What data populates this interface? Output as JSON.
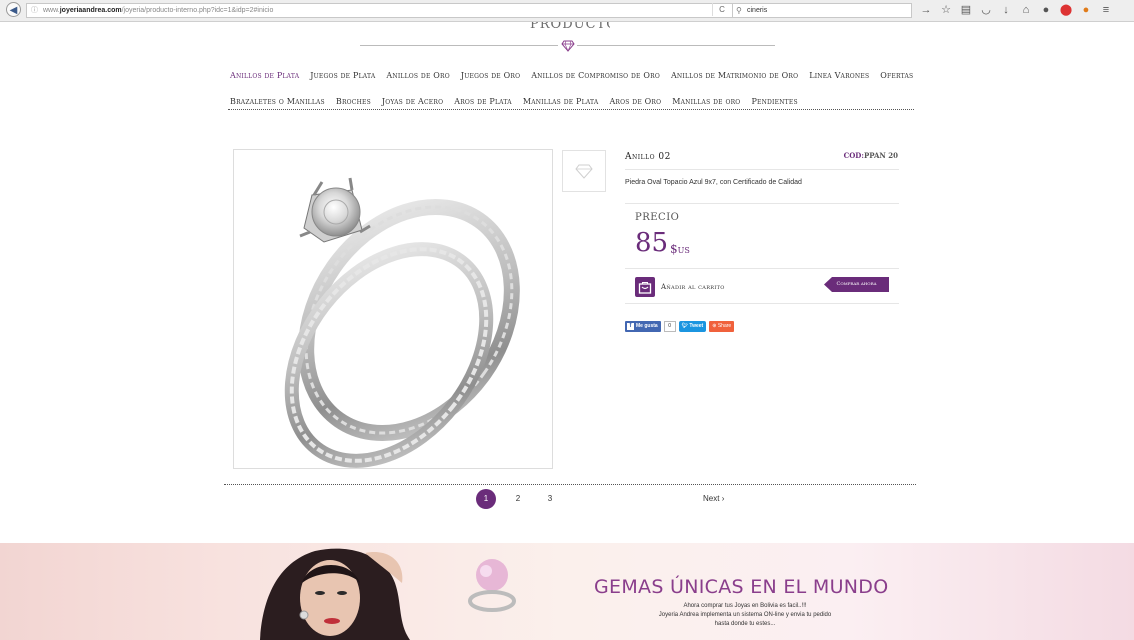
{
  "browser": {
    "url_prefix": "www.",
    "url_domain": "joyeriaandrea.com",
    "url_path": "/joyeria/producto-interno.php?idc=1&idp=2#inicio",
    "search_value": "cineris"
  },
  "header": {
    "logo_text": "PRODUCTOS"
  },
  "nav": {
    "row1": [
      "Anillos de Plata",
      "Juegos de Plata",
      "Anillos de Oro",
      "Juegos de Oro",
      "Anillos de Compromiso de Oro",
      "Anillos de Matrimonio de Oro",
      "Linea Varones",
      "Ofertas"
    ],
    "row2": [
      "Brazaletes o Manillas",
      "Broches",
      "Joyas de Acero",
      "Aros de Plata",
      "Manillas de Plata",
      "Aros de Oro",
      "Manillas de oro",
      "Pendientes"
    ],
    "active_index": 0
  },
  "product": {
    "title": "Anillo 02",
    "code_label": "COD:",
    "code_value": "PPAN 20",
    "description": "Piedra Oval Topacio Azul 9x7, con Certificado de Calidad",
    "price_label": "PRECIO",
    "price_value": "85",
    "price_unit": "$us",
    "add_to_cart": "Añadir al carrito",
    "buy_now": "Comprar ahora"
  },
  "social": {
    "like": "Me gusta",
    "like_count": "0",
    "tweet": "Tweet",
    "share": "Share"
  },
  "pagination": {
    "pages": [
      "1",
      "2",
      "3"
    ],
    "current": "1",
    "next": "Next"
  },
  "banner": {
    "title": "GEMAS ÚNICAS EN EL MUNDO",
    "line1": "Ahora comprar tus Joyas en Bolivia es facil..!!!",
    "line2": "Joyeria Andrea implementa un sistema ON-line y envia tu pedido",
    "line3": "hasta donde tu estes..."
  },
  "colors": {
    "accent": "#6a2c7a",
    "banner_title": "#8a3e8c"
  }
}
